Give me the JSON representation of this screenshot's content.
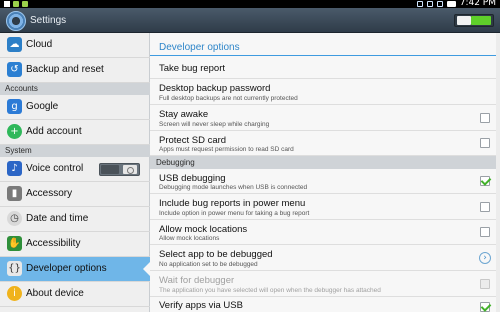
{
  "status_bar": {
    "time": "7:42 PM"
  },
  "action_bar": {
    "title": "Settings"
  },
  "sidebar": {
    "items": [
      {
        "label": "Cloud"
      },
      {
        "label": "Backup and reset"
      },
      {
        "label": "Google"
      },
      {
        "label": "Add account"
      },
      {
        "label": "Voice control"
      },
      {
        "label": "Accessory"
      },
      {
        "label": "Date and time"
      },
      {
        "label": "Accessibility"
      },
      {
        "label": "Developer options"
      },
      {
        "label": "About device"
      }
    ],
    "headers": {
      "accounts": "Accounts",
      "system": "System"
    }
  },
  "main": {
    "title": "Developer options",
    "section_debugging": "Debugging",
    "rows": [
      {
        "title": "Take bug report",
        "summary": ""
      },
      {
        "title": "Desktop backup password",
        "summary": "Full desktop backups are not currently protected"
      },
      {
        "title": "Stay awake",
        "summary": "Screen will never sleep while charging",
        "checked": false
      },
      {
        "title": "Protect SD card",
        "summary": "Apps must request permission to read SD card",
        "checked": false
      },
      {
        "title": "USB debugging",
        "summary": "Debugging mode launches when USB is connected",
        "checked": true
      },
      {
        "title": "Include bug reports in power menu",
        "summary": "Include option in power menu for taking a bug report",
        "checked": false
      },
      {
        "title": "Allow mock locations",
        "summary": "Allow mock locations",
        "checked": false
      },
      {
        "title": "Select app to be debugged",
        "summary": "No application set to be debugged"
      },
      {
        "title": "Wait for debugger",
        "summary": "The application you have selected will open when the debugger has attached",
        "checked": false,
        "disabled": true
      },
      {
        "title": "Verify apps via USB",
        "summary": "",
        "checked": true
      }
    ]
  },
  "colors": {
    "accent": "#3f9be0",
    "selected": "#6fb6e8",
    "check": "#42b22a"
  }
}
